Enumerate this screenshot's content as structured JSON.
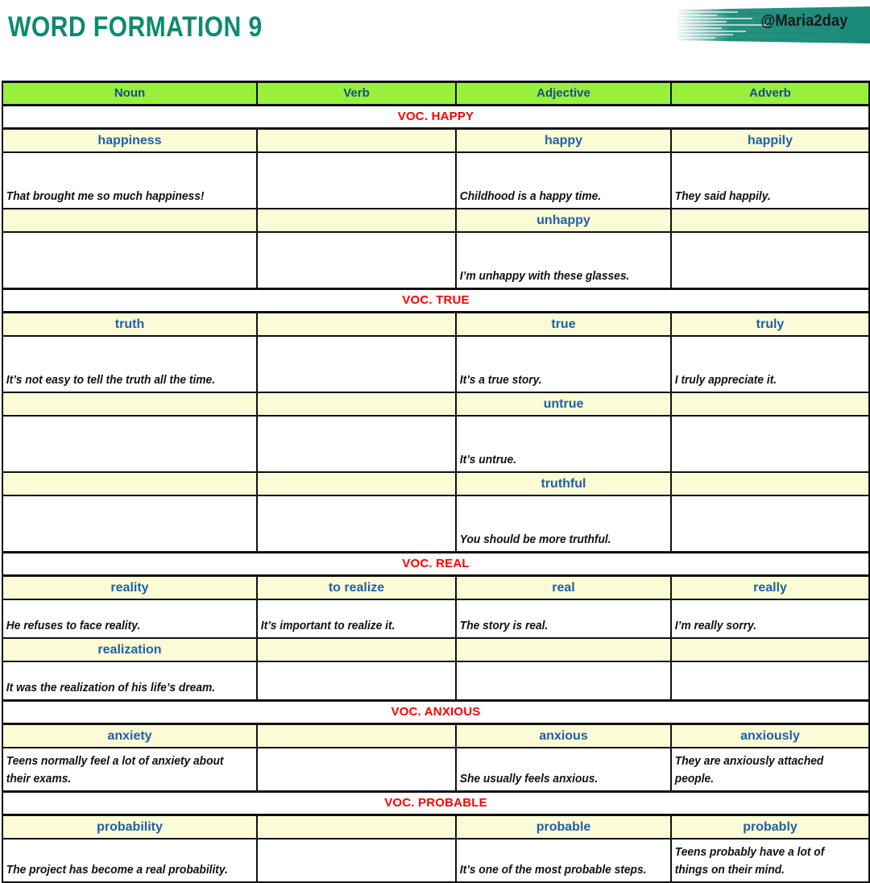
{
  "header": {
    "title": "WORD FORMATION 9",
    "brand_handle": "@Maria2day",
    "brand_color": "#1C8C7A",
    "title_color": "#0E8A6E"
  },
  "watermark": {
    "text": "@Maria2day"
  },
  "colors": {
    "header_green": "#99F03A",
    "word_cream": "#FBFBD6",
    "word_blue": "#1F60A8",
    "section_red": "#FF0000",
    "border_black": "#111111"
  },
  "table": {
    "columns": [
      "Noun",
      "Verb",
      "Adjective",
      "Adverb"
    ],
    "sections": [
      {
        "title": "VOC. HAPPY",
        "rows": [
          {
            "type": "word",
            "cells": [
              "happiness",
              "",
              "happy",
              "happily"
            ]
          },
          {
            "type": "example",
            "size": "tall",
            "cells": [
              "That brought me so much happiness!",
              "",
              "Childhood is a happy time.",
              "They said happily."
            ]
          },
          {
            "type": "word",
            "cells": [
              "",
              "",
              "unhappy",
              ""
            ]
          },
          {
            "type": "example",
            "size": "tall",
            "cells": [
              "",
              "",
              "I’m unhappy with these glasses.",
              ""
            ]
          }
        ]
      },
      {
        "title": "VOC. TRUE",
        "rows": [
          {
            "type": "word",
            "cells": [
              "truth",
              "",
              "true",
              "truly"
            ]
          },
          {
            "type": "example",
            "size": "tall",
            "cells": [
              "It’s not easy to tell the truth all the time.",
              "",
              "It’s a true story.",
              "I truly appreciate it."
            ]
          },
          {
            "type": "word",
            "cells": [
              "",
              "",
              "untrue",
              ""
            ]
          },
          {
            "type": "example",
            "size": "tall",
            "cells": [
              "",
              "",
              "It’s untrue.",
              ""
            ]
          },
          {
            "type": "word",
            "cells": [
              "",
              "",
              "truthful",
              ""
            ]
          },
          {
            "type": "example",
            "size": "tall",
            "cells": [
              "",
              "",
              "You should be more truthful.",
              ""
            ]
          }
        ]
      },
      {
        "title": "VOC. REAL",
        "rows": [
          {
            "type": "word",
            "cells": [
              "reality",
              "to realize",
              "real",
              "really"
            ]
          },
          {
            "type": "example",
            "size": "short",
            "cells": [
              "He refuses to face reality.",
              "It’s important to realize it.",
              "The story is real.",
              "I’m really sorry."
            ]
          },
          {
            "type": "word",
            "cells": [
              "realization",
              "",
              "",
              ""
            ]
          },
          {
            "type": "example",
            "size": "short",
            "cells": [
              "It was the realization of his life’s dream.",
              "",
              "",
              ""
            ]
          }
        ]
      },
      {
        "title": "VOC. ANXIOUS",
        "rows": [
          {
            "type": "word",
            "cells": [
              "anxiety",
              "",
              "anxious",
              "anxiously"
            ]
          },
          {
            "type": "example",
            "size": "two-line",
            "cells": [
              "Teens normally feel a lot of anxiety about their exams.",
              "",
              "She usually feels anxious.",
              "They are anxiously attached people."
            ]
          }
        ]
      },
      {
        "title": "VOC. PROBABLE",
        "rows": [
          {
            "type": "word",
            "cells": [
              "probability",
              "",
              "probable",
              "probably"
            ]
          },
          {
            "type": "example",
            "size": "two-line",
            "cells": [
              "The project has become a real probability.",
              "",
              "It’s one of the most probable steps.",
              "Teens probably have a lot of things on their mind."
            ]
          }
        ]
      }
    ]
  }
}
